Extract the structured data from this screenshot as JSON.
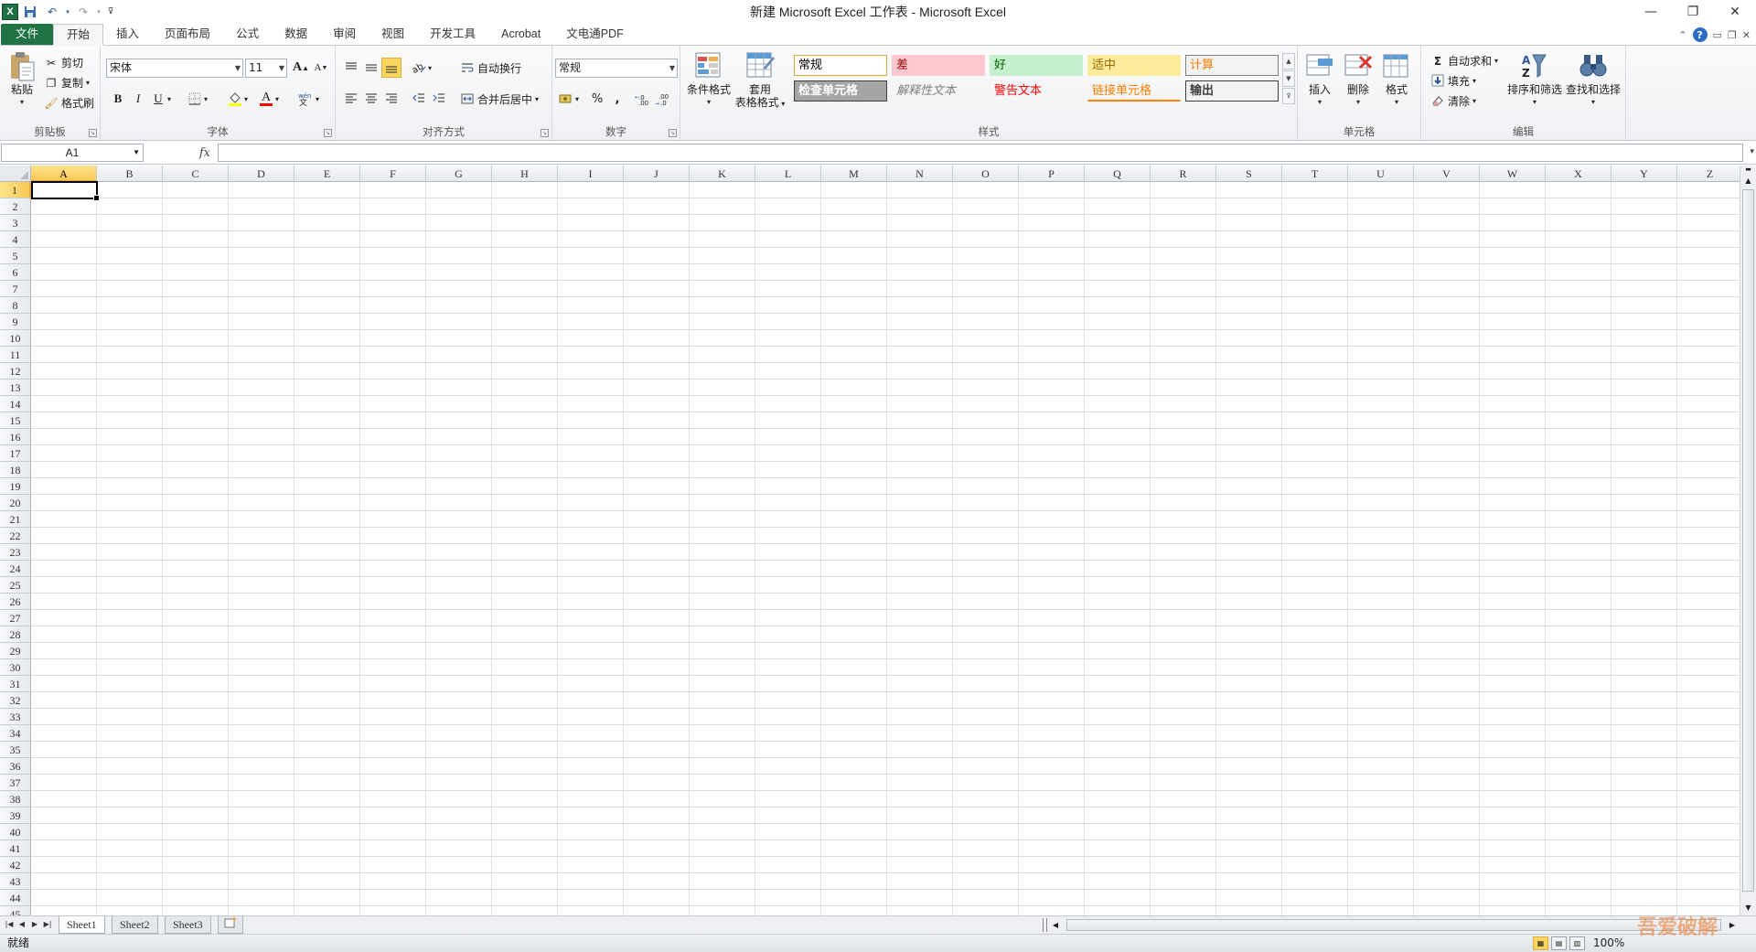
{
  "window": {
    "title": "新建 Microsoft Excel 工作表 - Microsoft Excel",
    "app_icon": "X"
  },
  "tabs": [
    {
      "label": "文件",
      "type": "file"
    },
    {
      "label": "开始",
      "active": true
    },
    {
      "label": "插入"
    },
    {
      "label": "页面布局"
    },
    {
      "label": "公式"
    },
    {
      "label": "数据"
    },
    {
      "label": "审阅"
    },
    {
      "label": "视图"
    },
    {
      "label": "开发工具"
    },
    {
      "label": "Acrobat"
    },
    {
      "label": "文电通PDF"
    }
  ],
  "ribbon": {
    "clipboard": {
      "label": "剪贴板",
      "paste": "粘贴",
      "cut": "剪切",
      "copy": "复制",
      "format_painter": "格式刷"
    },
    "font": {
      "label": "字体",
      "font_name": "宋体",
      "font_size": "11",
      "bold": "B",
      "italic": "I",
      "underline": "U",
      "grow": "A",
      "shrink": "A",
      "font_color": "A"
    },
    "alignment": {
      "label": "对齐方式",
      "wrap_text": "自动换行",
      "merge_center": "合并后居中"
    },
    "number": {
      "label": "数字",
      "format": "常规",
      "percent": "%",
      "comma": ","
    },
    "styles": {
      "label": "样式",
      "conditional": "条件格式",
      "table_format_1": "套用",
      "table_format_2": "表格格式",
      "cells": [
        {
          "text": "常规",
          "bg": "#ffffff",
          "fg": "#000000",
          "border": "#e2a63a"
        },
        {
          "text": "差",
          "bg": "#ffc7ce",
          "fg": "#9c0006"
        },
        {
          "text": "好",
          "bg": "#c6efce",
          "fg": "#006100"
        },
        {
          "text": "适中",
          "bg": "#ffeb9c",
          "fg": "#9c6500"
        },
        {
          "text": "计算",
          "bg": "#f2f2f2",
          "fg": "#fa7d00",
          "border": "#7f7f7f"
        },
        {
          "text": "检查单元格",
          "bg": "#a5a5a5",
          "fg": "#ffffff",
          "border": "#3f3f3f"
        },
        {
          "text": "解释性文本",
          "bg": "transparent",
          "fg": "#7f7f7f"
        },
        {
          "text": "警告文本",
          "bg": "transparent",
          "fg": "#ff0000"
        },
        {
          "text": "链接单元格",
          "bg": "transparent",
          "fg": "#fa7d00",
          "underline": "#ff8001"
        },
        {
          "text": "输出",
          "bg": "#f2f2f2",
          "fg": "#3f3f3f",
          "border": "#3f3f3f"
        }
      ]
    },
    "cells": {
      "label": "单元格",
      "insert": "插入",
      "delete": "删除",
      "format": "格式"
    },
    "editing": {
      "label": "编辑",
      "autosum": "自动求和",
      "fill": "填充",
      "clear": "清除",
      "sort_filter": "排序和筛选",
      "find_select": "查找和选择"
    }
  },
  "formula_bar": {
    "name_box": "A1",
    "fx": "fx",
    "value": ""
  },
  "grid": {
    "columns": [
      "A",
      "B",
      "C",
      "D",
      "E",
      "F",
      "G",
      "H",
      "I",
      "J",
      "K",
      "L",
      "M",
      "N",
      "O",
      "P",
      "Q",
      "R",
      "S",
      "T",
      "U",
      "V",
      "W",
      "X",
      "Y",
      "Z"
    ],
    "rows": [
      "1",
      "2",
      "3",
      "4",
      "5",
      "6",
      "7",
      "8",
      "9",
      "10",
      "11",
      "12",
      "13",
      "14",
      "15",
      "16",
      "17",
      "18",
      "19",
      "20",
      "21",
      "22",
      "23",
      "24",
      "25",
      "26",
      "27",
      "28",
      "29",
      "30",
      "31",
      "32",
      "33",
      "34",
      "35",
      "36",
      "37",
      "38",
      "39",
      "40",
      "41",
      "42",
      "43",
      "44",
      "45"
    ],
    "selected_col": "A",
    "selected_row": "1"
  },
  "sheets": [
    {
      "name": "Sheet1",
      "active": true
    },
    {
      "name": "Sheet2"
    },
    {
      "name": "Sheet3"
    }
  ],
  "status": {
    "ready": "就绪",
    "zoom": "100%"
  },
  "watermark": "吾爱破解"
}
